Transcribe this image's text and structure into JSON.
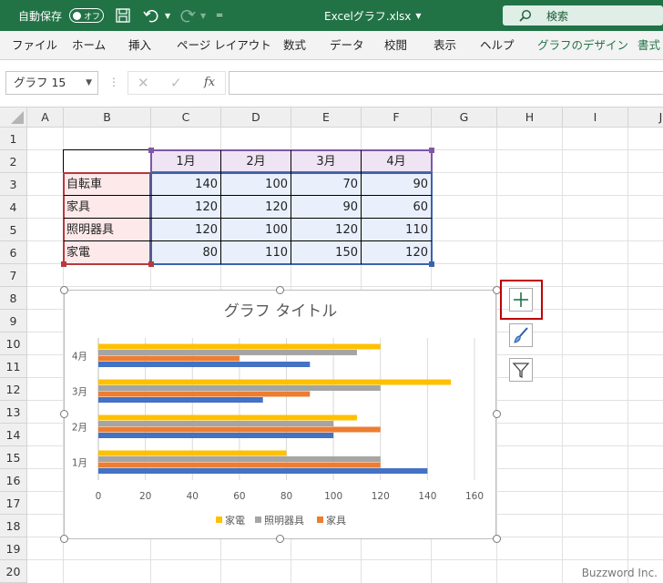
{
  "titlebar": {
    "autosave_label": "自動保存",
    "autosave_state": "オフ",
    "filename": "Excelグラフ.xlsx",
    "search_label": "検索",
    "accent": "#217346"
  },
  "tabs": [
    "ファイル",
    "ホーム",
    "挿入",
    "ページ レイアウト",
    "数式",
    "データ",
    "校閲",
    "表示",
    "ヘルプ",
    "グラフのデザイン",
    "書式"
  ],
  "formula_bar": {
    "name_box": "グラフ 15",
    "formula": ""
  },
  "columns": [
    "A",
    "B",
    "C",
    "D",
    "E",
    "F",
    "G",
    "H",
    "I",
    "J"
  ],
  "rows": [
    "1",
    "2",
    "3",
    "4",
    "5",
    "6",
    "7",
    "8",
    "9",
    "10",
    "11",
    "12",
    "13",
    "14",
    "15",
    "16",
    "17",
    "18",
    "19",
    "20"
  ],
  "table": {
    "header": [
      "1月",
      "2月",
      "3月",
      "4月"
    ],
    "row_labels": [
      "自転車",
      "家具",
      "照明器具",
      "家電"
    ],
    "values": [
      [
        "140",
        "100",
        "70",
        "90"
      ],
      [
        "120",
        "120",
        "90",
        "60"
      ],
      [
        "120",
        "100",
        "120",
        "110"
      ],
      [
        "80",
        "110",
        "150",
        "120"
      ]
    ]
  },
  "chart_data": {
    "type": "bar",
    "orientation": "horizontal",
    "title": "グラフ タイトル",
    "categories": [
      "1月",
      "2月",
      "3月",
      "4月"
    ],
    "series": [
      {
        "name": "自転車",
        "color": "#4472c4",
        "values": [
          140,
          100,
          70,
          90
        ]
      },
      {
        "name": "家具",
        "color": "#ed7d31",
        "values": [
          120,
          120,
          90,
          60
        ]
      },
      {
        "name": "照明器具",
        "color": "#a5a5a5",
        "values": [
          120,
          100,
          120,
          110
        ]
      },
      {
        "name": "家電",
        "color": "#ffc000",
        "values": [
          80,
          110,
          150,
          120
        ]
      }
    ],
    "xlim": [
      0,
      160
    ],
    "xticks": [
      "0",
      "20",
      "40",
      "60",
      "80",
      "100",
      "120",
      "140",
      "160"
    ],
    "legend_visible": [
      "家電",
      "照明器具",
      "家具"
    ],
    "legend_placement": "bottom",
    "grid": true
  },
  "watermark": "Buzzword Inc."
}
